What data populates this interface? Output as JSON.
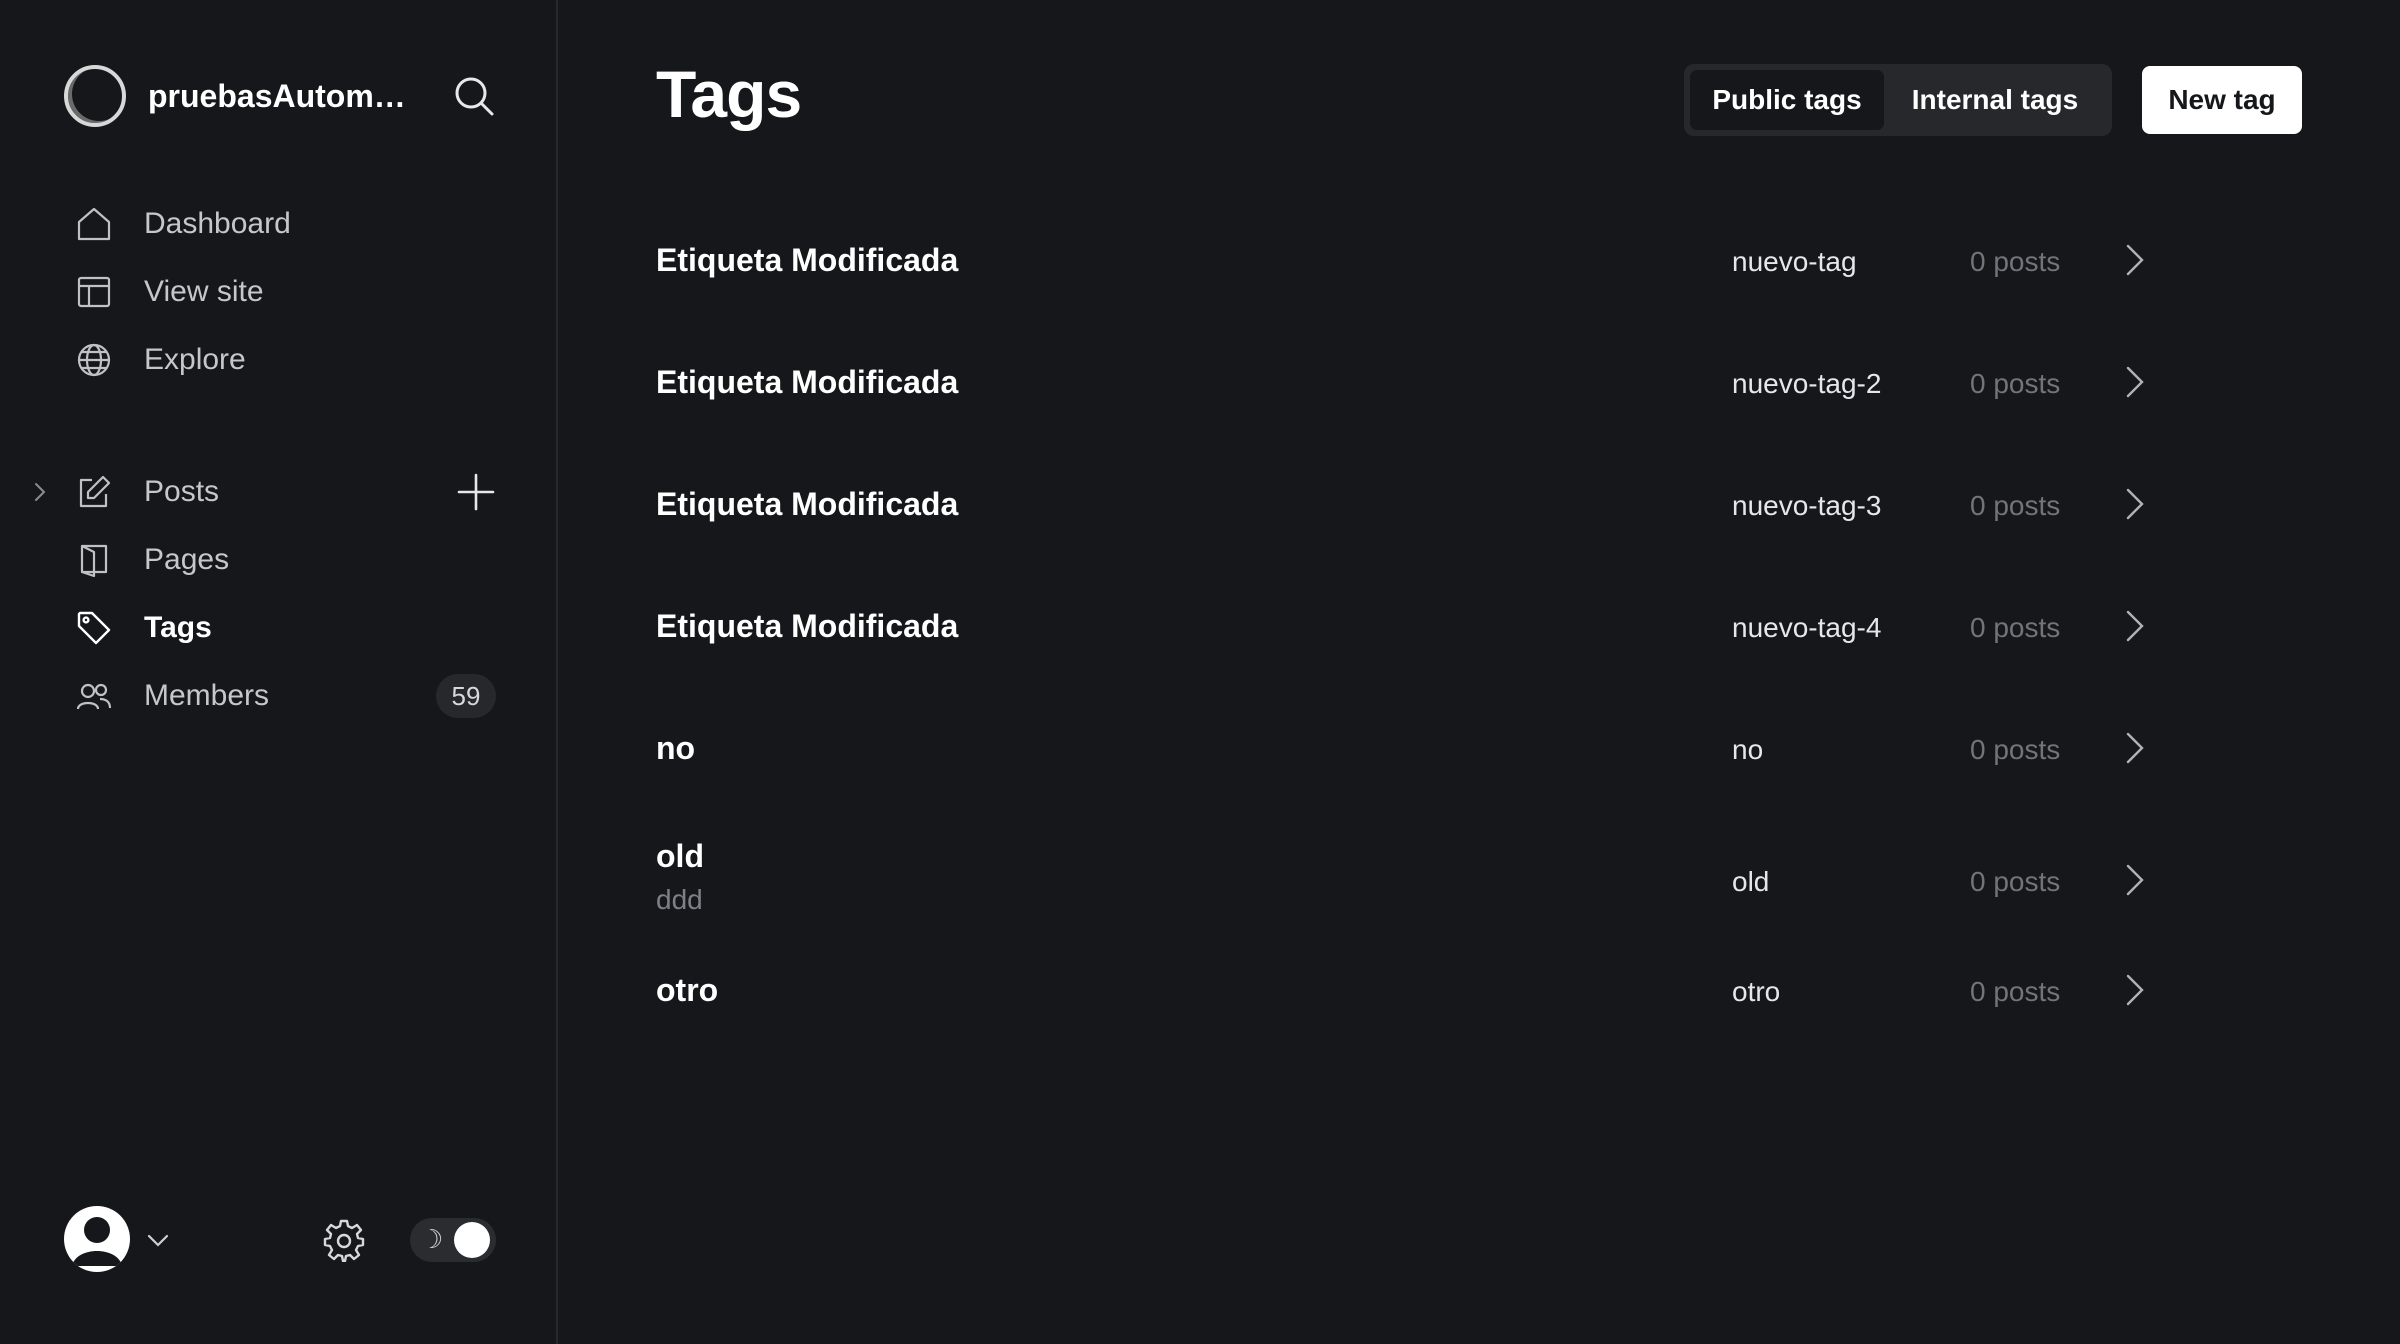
{
  "site": {
    "name": "pruebasAutomatizadas"
  },
  "nav_top": [
    {
      "label": "Dashboard",
      "icon": "home-icon"
    },
    {
      "label": "View site",
      "icon": "layout-icon"
    },
    {
      "label": "Explore",
      "icon": "globe-icon"
    }
  ],
  "nav_main": [
    {
      "label": "Posts",
      "icon": "edit-icon"
    },
    {
      "label": "Pages",
      "icon": "pages-icon"
    },
    {
      "label": "Tags",
      "icon": "tag-icon",
      "active": true
    },
    {
      "label": "Members",
      "icon": "members-icon",
      "count": "59"
    }
  ],
  "header": {
    "title": "Tags",
    "tab_public": "Public tags",
    "tab_internal": "Internal tags",
    "selected_tab": "Public tags",
    "new_tag_label": "New tag"
  },
  "tags": [
    {
      "name": "Etiqueta Modificada",
      "description": "",
      "slug": "nuevo-tag",
      "count": "0 posts"
    },
    {
      "name": "Etiqueta Modificada",
      "description": "",
      "slug": "nuevo-tag-2",
      "count": "0 posts"
    },
    {
      "name": "Etiqueta Modificada",
      "description": "",
      "slug": "nuevo-tag-3",
      "count": "0 posts"
    },
    {
      "name": "Etiqueta Modificada",
      "description": "",
      "slug": "nuevo-tag-4",
      "count": "0 posts"
    },
    {
      "name": "no",
      "description": "",
      "slug": "no",
      "count": "0 posts"
    },
    {
      "name": "old",
      "description": "ddd",
      "slug": "old",
      "count": "0 posts"
    },
    {
      "name": "otro",
      "description": "",
      "slug": "otro",
      "count": "0 posts"
    }
  ],
  "footer": {
    "theme_icon": "moon-icon",
    "theme_mode": "dark"
  },
  "colors": {
    "background": "#15171a",
    "sidebar_border": "#26282b",
    "text_primary": "#ffffff",
    "text_secondary": "#c5c7c9",
    "text_muted": "#71757b",
    "button_primary_bg": "#ffffff"
  }
}
